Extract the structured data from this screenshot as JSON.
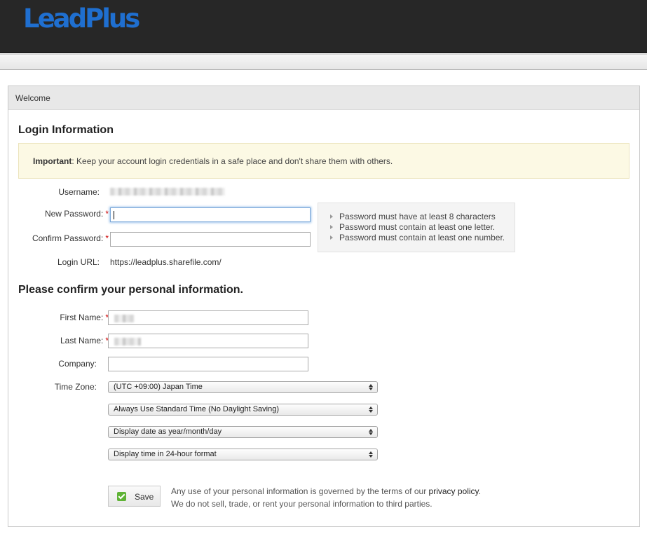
{
  "brand": {
    "name": "LeadPlus"
  },
  "panel": {
    "title": "Welcome"
  },
  "login_section": {
    "title": "Login Information",
    "notice": {
      "label": "Important",
      "text": ": Keep your account login credentials in a safe place and don't share them with others."
    },
    "username_label": "Username:",
    "new_password_label": "New Password:",
    "confirm_password_label": "Confirm Password:",
    "required_marker": "*",
    "login_url_label": "Login URL:",
    "login_url": "https://leadplus.sharefile.com/",
    "password_rules": [
      "Password must have at least 8 characters",
      "Password must contain at least one letter.",
      "Password must contain at least one number."
    ]
  },
  "personal_section": {
    "title": "Please confirm your personal information.",
    "first_name_label": "First Name:",
    "last_name_label": "Last Name:",
    "company_label": "Company:",
    "time_zone_label": "Time Zone:",
    "time_zone": "(UTC +09:00) Japan Time",
    "dst": "Always Use Standard Time (No Daylight Saving)",
    "date_format": "Display date as year/month/day",
    "time_format": "Display time in 24-hour format"
  },
  "actions": {
    "save_label": "Save"
  },
  "legal": {
    "line1_prefix": "Any use of your personal information is governed by the terms of our ",
    "privacy_link": "privacy policy",
    "line1_suffix": ".",
    "line2": "We do not sell, trade, or rent your personal information to third parties."
  },
  "colors": {
    "header_bg": "#272727",
    "logo": "#1f6fd0",
    "notice_bg": "#fcf9e4",
    "required": "#cc0000",
    "save_check": "#5fb336"
  },
  "icons": {
    "save": "checkmark-icon",
    "hint_bullet": "triangle-right-icon",
    "select": "up-down-arrows-icon"
  }
}
